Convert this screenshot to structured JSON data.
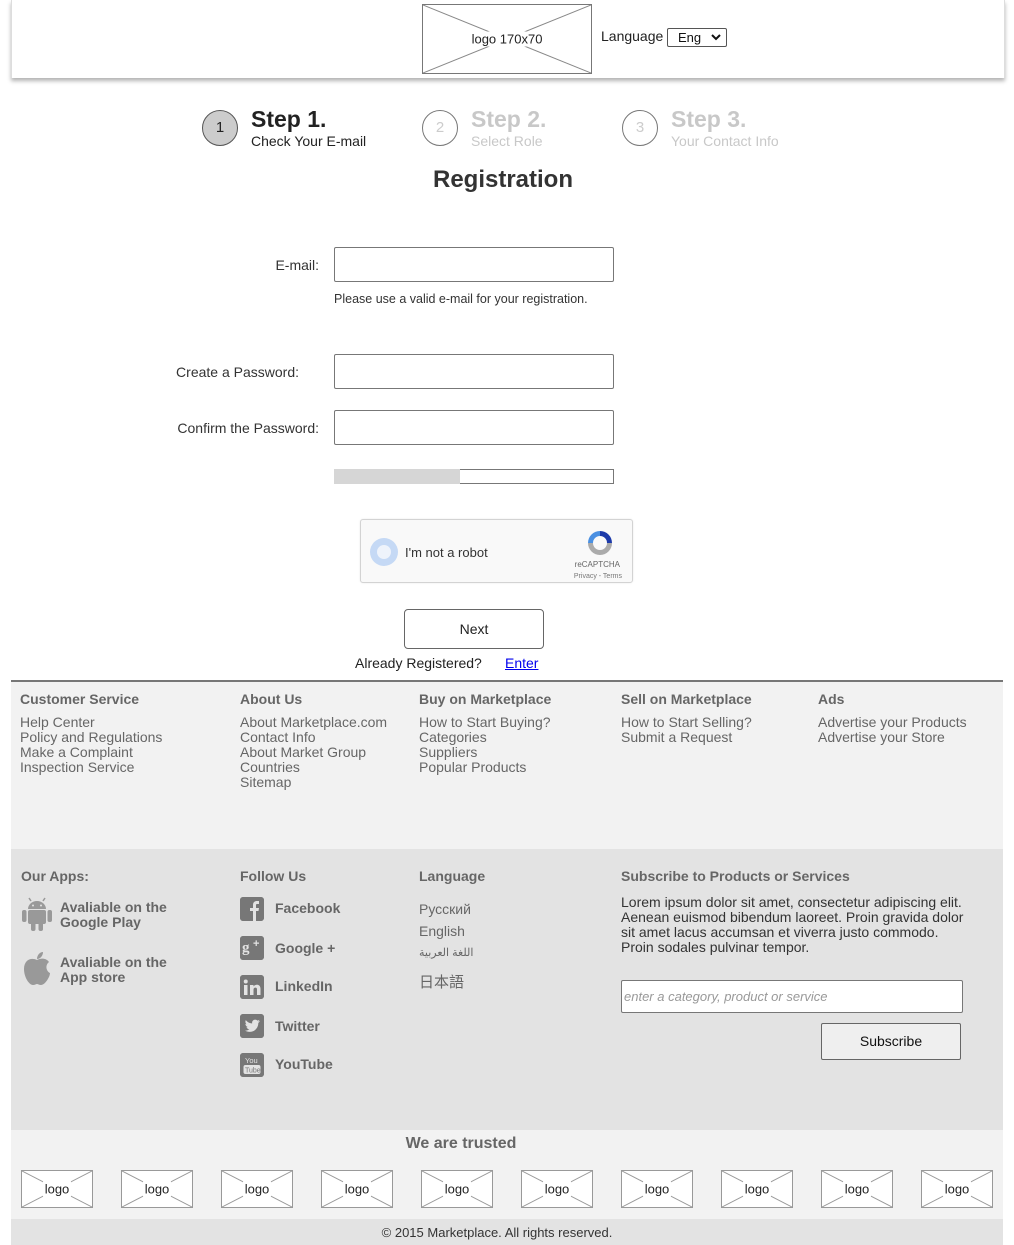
{
  "header": {
    "logo_text": "logo 170x70",
    "language_label": "Language",
    "language_selected": "Eng"
  },
  "steps": [
    {
      "number": "1",
      "title": "Step 1.",
      "subtitle": "Check Your E-mail",
      "state": "active"
    },
    {
      "number": "2",
      "title": "Step 2.",
      "subtitle": "Select Role",
      "state": "inactive"
    },
    {
      "number": "3",
      "title": "Step 3.",
      "subtitle": "Your Contact Info",
      "state": "inactive"
    }
  ],
  "form": {
    "title": "Registration",
    "email_label": "E-mail:",
    "email_value": "",
    "email_hint": "Please use a valid e-mail for your registration.",
    "password_label": "Create a Password:",
    "password_value": "",
    "confirm_label": "Confirm the Password:",
    "confirm_value": "",
    "password_strength_percent": 45,
    "recaptcha": {
      "label": "I'm not a robot",
      "brand": "reCAPTCHA",
      "links": "Privacy - Terms"
    },
    "next_label": "Next",
    "already_registered": "Already Registered?",
    "enter_link": "Enter"
  },
  "footer_columns": [
    {
      "heading": "Customer Service",
      "links": [
        "Help Center",
        "Policy and Regulations",
        "Make a Complaint",
        "Inspection Service"
      ]
    },
    {
      "heading": "About Us",
      "links": [
        "About Marketplace.com",
        "Contact Info",
        "About Market Group",
        "Countries",
        "Sitemap"
      ]
    },
    {
      "heading": "Buy on Marketplace",
      "links": [
        "How to Start Buying?",
        "Categories",
        "Suppliers",
        "Popular Products"
      ]
    },
    {
      "heading": "Sell on Marketplace",
      "links": [
        "How to Start Selling?",
        "Submit a Request"
      ]
    },
    {
      "heading": "Ads",
      "links": [
        "Advertise your Products",
        "Advertise your Store"
      ]
    }
  ],
  "apps": {
    "heading": "Our Apps:",
    "items": [
      {
        "icon": "android-icon",
        "line1": "Avaliable on the",
        "line2": "Google Play"
      },
      {
        "icon": "apple-icon",
        "line1": "Avaliable on the",
        "line2": "App store"
      }
    ]
  },
  "follow": {
    "heading": "Follow Us",
    "items": [
      {
        "icon": "facebook-icon",
        "label": "Facebook"
      },
      {
        "icon": "google-plus-icon",
        "label": "Google +"
      },
      {
        "icon": "linkedin-icon",
        "label": "LinkedIn"
      },
      {
        "icon": "twitter-icon",
        "label": "Twitter"
      },
      {
        "icon": "youtube-icon",
        "label": "YouTube"
      }
    ]
  },
  "languages": {
    "heading": "Language",
    "items": [
      "Русский",
      "English",
      "اللغة العربية",
      "日本語"
    ]
  },
  "subscribe": {
    "heading": "Subscribe to Products or Services",
    "text": "Lorem ipsum dolor sit amet, consectetur adipiscing elit. Aenean euismod bibendum laoreet. Proin gravida dolor sit amet lacus accumsan et viverra justo commodo. Proin sodales pulvinar tempor.",
    "placeholder": "enter a category, product or service",
    "button": "Subscribe"
  },
  "trusted": {
    "title": "We are trusted",
    "logos": [
      "logo",
      "logo",
      "logo",
      "logo",
      "logo",
      "logo",
      "logo",
      "logo",
      "logo",
      "logo"
    ]
  },
  "copyright": "© 2015 Marketplace. All rights reserved."
}
